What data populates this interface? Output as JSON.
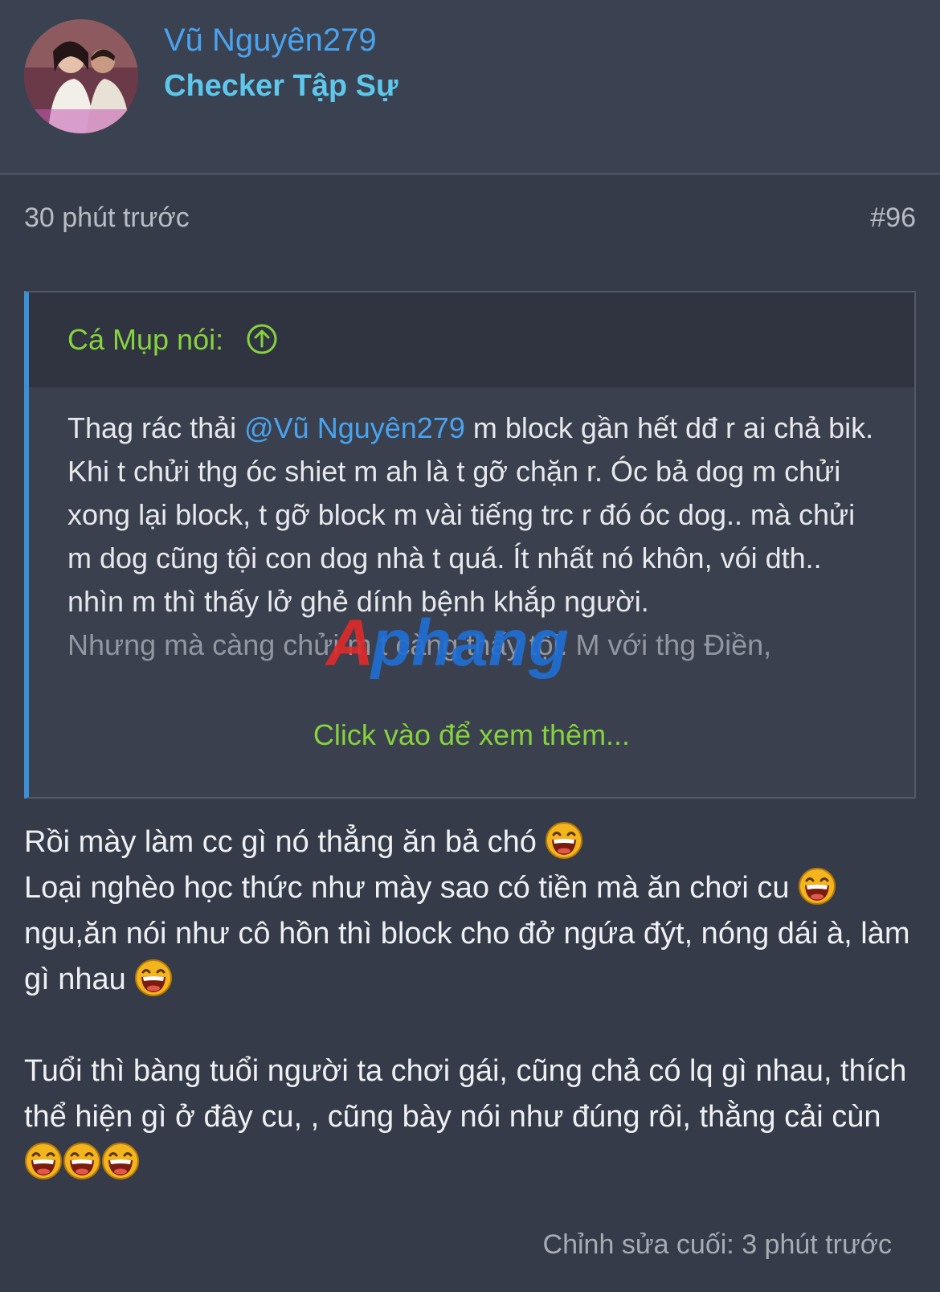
{
  "user": {
    "name": "Vũ Nguyên279",
    "title": "Checker Tập Sự"
  },
  "post": {
    "time": "30 phút trước",
    "number": "#96",
    "edited": "Chỉnh sửa cuối: 3 phút trước"
  },
  "quote": {
    "author": "Cá Mụp nói:",
    "text_before_mention": "Thag rác thải ",
    "mention": "@Vũ Nguyên279",
    "text_after_mention": " m block gần hết dđ r ai chả bik. Khi t chửi thg óc shiet m ah là t gỡ chặn r. Óc bả dog m chửi xong lại block, t gỡ block m vài tiếng trc r đó óc dog.. mà chửi m dog cũng tội con dog nhà t quá. Ít nhất nó khôn, vói dth.. nhìn m thì thấy lở ghẻ dính bệnh khắp người.",
    "faded_text": "Nhưng mà càng chửi m t càng thấy tội. M với thg Điền,",
    "read_more": "Click vào để xem thêm..."
  },
  "watermark": "Aphang",
  "message": {
    "line1": "Rồi mày làm cc gì nó thẳng ăn bả chó",
    "line2": "Loại nghèo học thức như mày sao có tiền mà ăn chơi cu",
    "line3": "ngu,ăn nói như cô hồn thì block cho đở ngứa đýt, nóng dái à, làm gì nhau",
    "line4": "Tuổi thì bàng tuổi người ta chơi gái, cũng chả có lq gì nhau, thích thể hiện gì ở đây cu, , cũng bày nói như đúng rôi, thằng cải cùn"
  },
  "icons": {
    "quote_arrow": "arrow-up-circle-icon",
    "emoji": "laughing-emoji-icon",
    "avatar": "avatar"
  },
  "colors": {
    "background": "#353b48",
    "username": "#4aa3ef",
    "user_title": "#5ec8ec",
    "quote_author": "#86d23f",
    "quote_border": "#3d8fd6"
  }
}
